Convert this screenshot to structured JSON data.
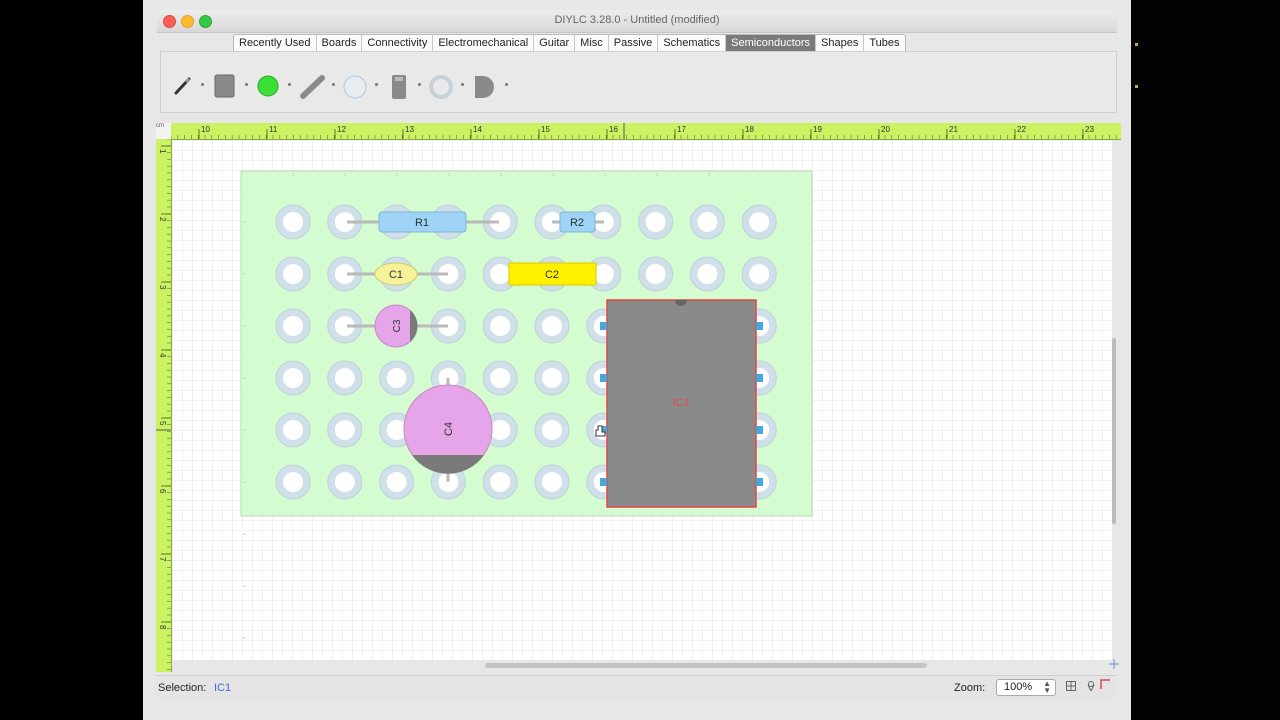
{
  "window": {
    "title": "DIYLC 3.28.0 - Untitled  (modified)"
  },
  "tabs": [
    {
      "label": "Recently Used",
      "active": false
    },
    {
      "label": "Boards",
      "active": false
    },
    {
      "label": "Connectivity",
      "active": false
    },
    {
      "label": "Electromechanical",
      "active": false
    },
    {
      "label": "Guitar",
      "active": false
    },
    {
      "label": "Misc",
      "active": false
    },
    {
      "label": "Passive",
      "active": false
    },
    {
      "label": "Schematics",
      "active": false
    },
    {
      "label": "Semiconductors",
      "active": true
    },
    {
      "label": "Shapes",
      "active": false
    },
    {
      "label": "Tubes",
      "active": false
    }
  ],
  "toolbox": {
    "icons": [
      "pencil-icon",
      "dark-square-icon",
      "green-circle-icon",
      "diagonal-bar-icon",
      "light-circle-icon",
      "small-chip-icon",
      "ring-icon",
      "d-shape-icon"
    ]
  },
  "ruler": {
    "unit": "cm",
    "top_labels": [
      "10",
      "11",
      "12",
      "13",
      "14",
      "15",
      "16",
      "17",
      "18",
      "19",
      "20",
      "21",
      "22",
      "23"
    ],
    "left_labels": [
      "1",
      "2",
      "3",
      "4",
      "5",
      "6",
      "7",
      "8"
    ]
  },
  "components": {
    "r1": "R1",
    "r2": "R2",
    "c1": "C1",
    "c2": "C2",
    "c3": "C3",
    "c4": "C4",
    "ic1": "IC1"
  },
  "colors": {
    "board": "#d4fcd0",
    "resistor": "#9fd4f7",
    "film_cap": "#fff000",
    "ceramic_cap": "#f6f29a",
    "electrolytic": "#e6a5e8",
    "ic_body": "#8a8a8a",
    "ic_border": "#e04848",
    "ruler": "#caf262"
  },
  "status": {
    "selection_label": "Selection:",
    "selection_value": "IC1",
    "zoom_label": "Zoom:",
    "zoom_value": "100%"
  }
}
